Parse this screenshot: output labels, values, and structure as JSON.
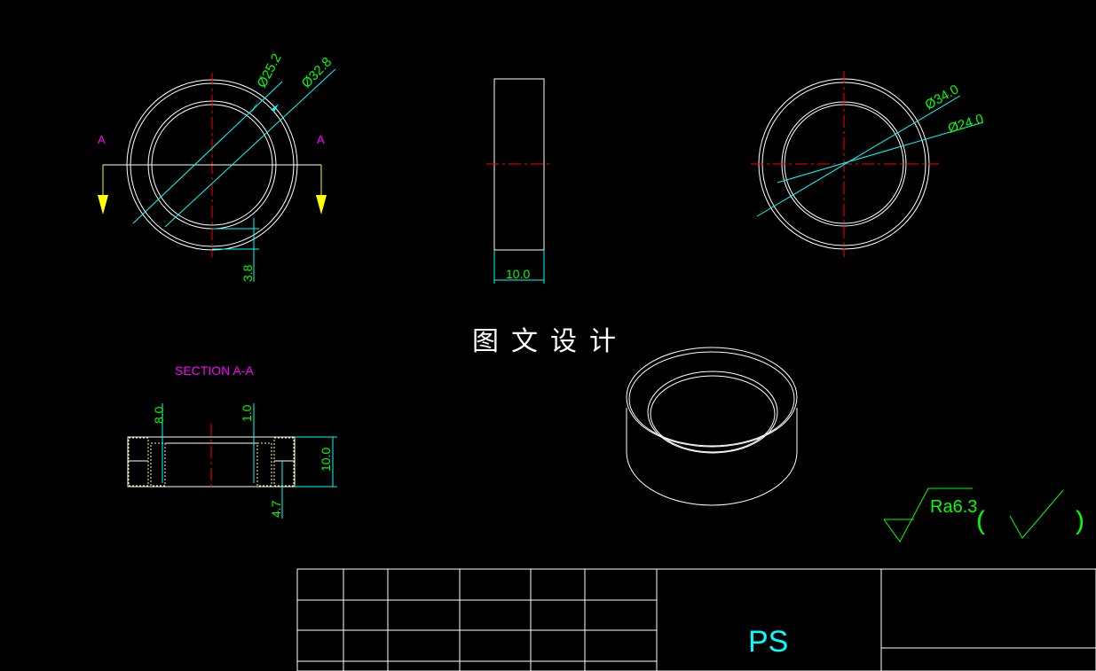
{
  "drawing": {
    "watermark": "图文设计",
    "section_marker": "A",
    "section_title": "SECTION A-A",
    "title_block_label": "PS",
    "surface_finish": {
      "ra": "Ra6.3",
      "bracket_open": "(",
      "bracket_close": ")"
    },
    "dimensions": {
      "front_view": {
        "inner_dia": "Ø25.2",
        "outer_dia": "Ø32.8",
        "wall": "3.8"
      },
      "side_view": {
        "thickness": "10.0"
      },
      "rear_view": {
        "outer_dia": "Ø34.0",
        "inner_dia": "Ø24.0"
      },
      "section": {
        "depth": "8.0",
        "step": "1.0",
        "height": "10.0",
        "bottom": "4.7"
      }
    },
    "colors": {
      "background": "#000000",
      "outline": "#ffffff",
      "centerline": "#ff0000",
      "dimension": "#00ffff",
      "dim_text": "#00ff00",
      "marker": "#ff00ff",
      "arrow": "#ffff00",
      "hatch": "#ffff80"
    }
  }
}
